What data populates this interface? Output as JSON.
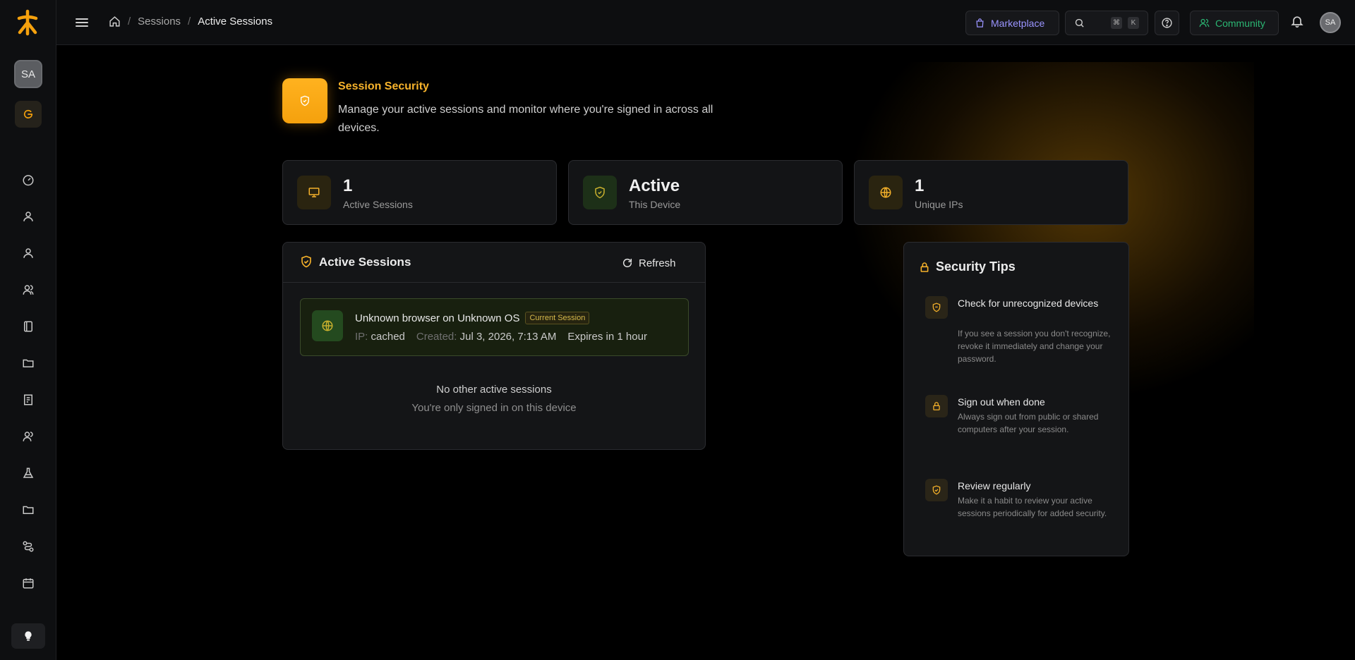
{
  "sidebar": {
    "avatar_initials": "SA",
    "nav_icons": [
      "dashboard-icon",
      "user-icon",
      "user-icon",
      "users-icon",
      "book-icon",
      "folder-icon",
      "receipt-icon",
      "users-icon",
      "flask-icon",
      "folder-icon",
      "route-icon",
      "calendar-icon"
    ],
    "bottom_icon": "lightbulb-icon"
  },
  "topbar": {
    "breadcrumb": {
      "section": "Sessions",
      "current": "Active Sessions"
    },
    "marketplace_label": "Marketplace",
    "search_kbd": [
      "⌘",
      "K"
    ],
    "community_label": "Community",
    "avatar_initials": "SA"
  },
  "header": {
    "title": "Session Security",
    "description": "Manage your active sessions and monitor where you're signed in across all devices."
  },
  "stats": [
    {
      "value": "1",
      "label": "Active Sessions",
      "icon": "monitor-icon"
    },
    {
      "value": "Active",
      "label": "This Device",
      "icon": "shield-icon"
    },
    {
      "value": "1",
      "label": "Unique IPs",
      "icon": "globe-icon"
    }
  ],
  "sessions_panel": {
    "title": "Active Sessions",
    "refresh_label": "Refresh",
    "current": {
      "name": "Unknown browser on Unknown OS",
      "badge": "Current Session",
      "ip_label": "IP:",
      "ip": "cached",
      "created_label": "Created:",
      "created": "Jul 3, 2026, 7:13 AM",
      "expires": "Expires in 1 hour"
    },
    "empty_title": "No other active sessions",
    "empty_subtitle": "You're only signed in on this device"
  },
  "tips": {
    "title": "Security Tips",
    "items": [
      {
        "title": "Check for unrecognized devices",
        "text": "If you see a session you don't recognize, revoke it immediately and change your password.",
        "icon": "shield-icon"
      },
      {
        "title": "Sign out when done",
        "text": "Always sign out from public or shared computers after your session.",
        "icon": "lock-icon"
      },
      {
        "title": "Review regularly",
        "text": "Make it a habit to review your active sessions periodically for added security.",
        "icon": "shield-check-icon"
      }
    ]
  },
  "colors": {
    "accent": "#f7b32b",
    "green": "#2bb673",
    "purple": "#9a94ff"
  }
}
